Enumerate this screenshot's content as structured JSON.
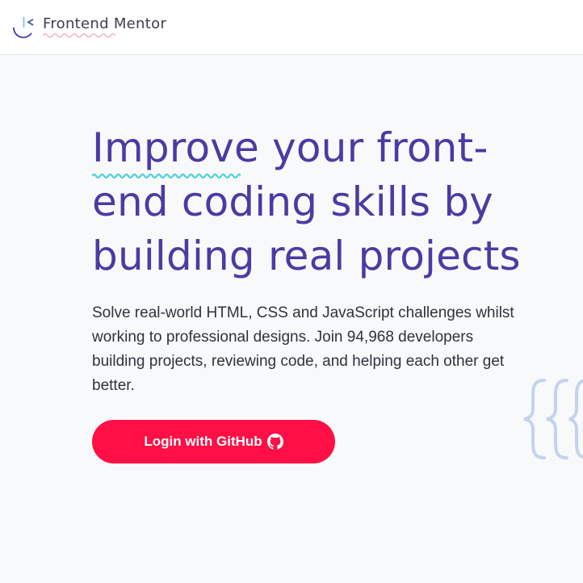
{
  "header": {
    "brand_name": "Frontend Mentor",
    "brand_colors": {
      "line": "#7ac8d4",
      "chevron": "#3e54a3",
      "curve": "#4d3aa3",
      "squiggle": "#f6a6b6"
    }
  },
  "hero": {
    "headline_highlight": "Improve",
    "headline_rest": " your front-end coding skills by building real projects",
    "description": "Solve real-world HTML, CSS and JavaScript challenges whilst working to professional designs. Join 94,968 developers building projects, reviewing code, and helping each other get better.",
    "headline_color": "#4d3aa3",
    "underline_color": "#4fd1d9"
  },
  "cta": {
    "label": "Login with GitHub",
    "icon": "github-icon",
    "background": "#ff0f46"
  },
  "decoration": {
    "icon": "curly-braces-icon",
    "color": "#c4d2ee"
  }
}
